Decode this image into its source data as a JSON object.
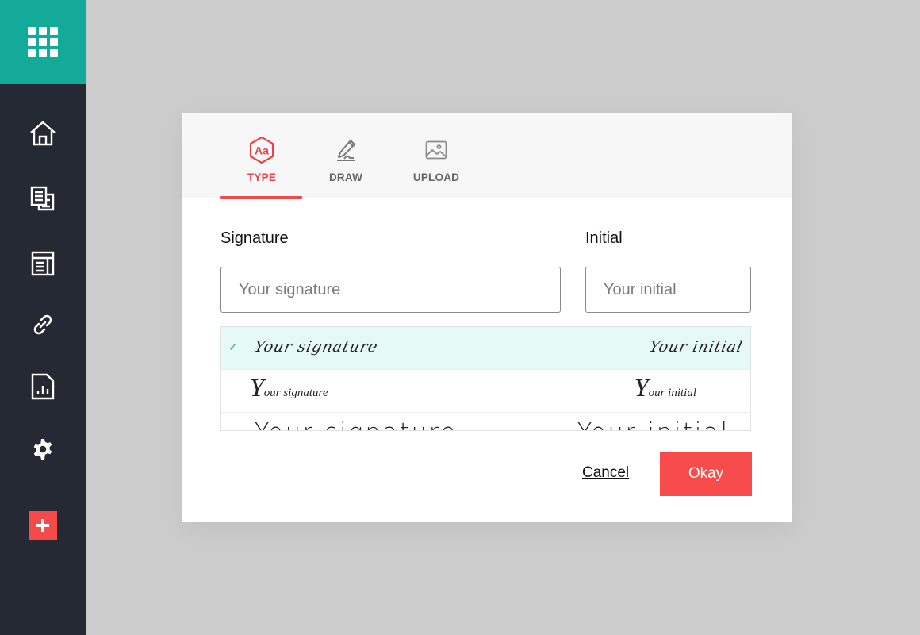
{
  "sidebar": {
    "apps_icon": "apps-grid-icon",
    "items": [
      {
        "name": "home",
        "icon": "home-icon"
      },
      {
        "name": "documents",
        "icon": "documents-icon"
      },
      {
        "name": "templates",
        "icon": "template-icon"
      },
      {
        "name": "links",
        "icon": "link-icon"
      },
      {
        "name": "reports",
        "icon": "report-icon"
      },
      {
        "name": "settings",
        "icon": "gear-icon"
      }
    ],
    "add_icon": "plus-icon",
    "colors": {
      "apps_bg": "#13aa9a",
      "bg": "#242933",
      "add_bg": "#f44a4a"
    }
  },
  "dialog": {
    "tabs": [
      {
        "label": "TYPE",
        "icon": "type-aa-icon",
        "active": true
      },
      {
        "label": "DRAW",
        "icon": "pen-draw-icon",
        "active": false
      },
      {
        "label": "UPLOAD",
        "icon": "image-upload-icon",
        "active": false
      }
    ],
    "signature": {
      "label": "Signature",
      "placeholder": "Your signature",
      "value": ""
    },
    "initial": {
      "label": "Initial",
      "placeholder": "Your initial",
      "value": ""
    },
    "styles": [
      {
        "signature": "Your signature",
        "initial": "Your initial",
        "selected": true
      },
      {
        "signature_first": "Y",
        "signature_rest": "our signature",
        "initial_first": "Y",
        "initial_rest": "our initial",
        "selected": false
      },
      {
        "signature": "Your signature",
        "initial": "Your initial",
        "selected": false
      }
    ],
    "cancel_label": "Cancel",
    "okay_label": "Okay",
    "accent": "#f84b4b"
  }
}
